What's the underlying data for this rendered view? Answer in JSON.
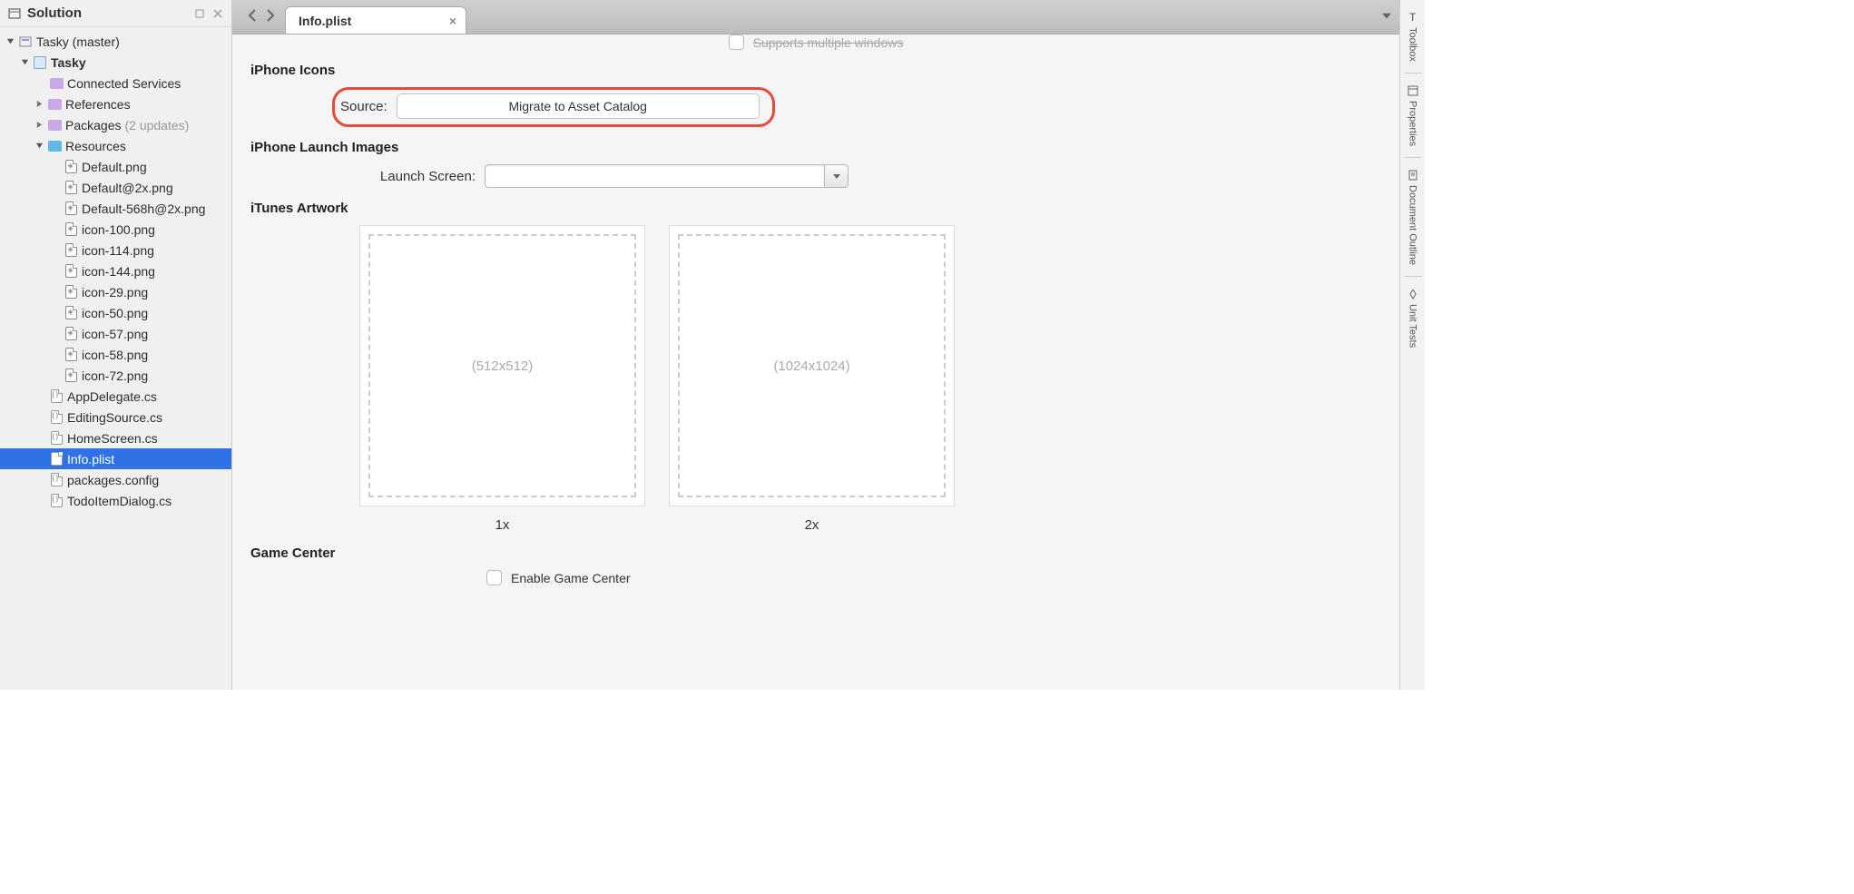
{
  "panel": {
    "title": "Solution"
  },
  "tree": {
    "solution": "Tasky (master)",
    "project": "Tasky",
    "connected_services": "Connected Services",
    "references": "References",
    "packages": "Packages",
    "packages_updates": "(2 updates)",
    "resources": "Resources",
    "files": [
      "Default.png",
      "Default@2x.png",
      "Default-568h@2x.png",
      "icon-100.png",
      "icon-114.png",
      "icon-144.png",
      "icon-29.png",
      "icon-50.png",
      "icon-57.png",
      "icon-58.png",
      "icon-72.png"
    ],
    "root_files": [
      "AppDelegate.cs",
      "EditingSource.cs",
      "HomeScreen.cs",
      "Info.plist",
      "packages.config",
      "TodoItemDialog.cs"
    ]
  },
  "editor": {
    "tab": "Info.plist",
    "cutoff_checkbox_label": "Supports multiple windows",
    "sections": {
      "iphone_icons": "iPhone Icons",
      "iphone_launch": "iPhone Launch Images",
      "itunes_artwork": "iTunes Artwork",
      "game_center": "Game Center"
    },
    "source_label": "Source:",
    "source_button": "Migrate to Asset Catalog",
    "launch_label": "Launch Screen:",
    "artwork": {
      "size1": "(512x512)",
      "size2": "(1024x1024)",
      "label1": "1x",
      "label2": "2x"
    },
    "enable_gc": "Enable Game Center"
  },
  "right_tabs": [
    "Toolbox",
    "Properties",
    "Document Outline",
    "Unit Tests"
  ]
}
